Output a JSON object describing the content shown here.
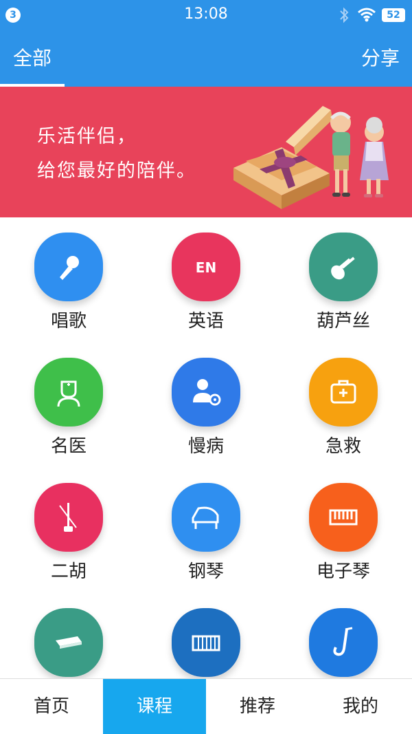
{
  "status_bar": {
    "notification_count": "3",
    "time": "13:08",
    "battery": "52",
    "icons": [
      "bluetooth-icon",
      "wifi-icon",
      "battery-icon"
    ]
  },
  "header": {
    "tab_all": "全部",
    "share": "分享"
  },
  "banner": {
    "line1": "乐活伴侣，",
    "line2": "给您最好的陪伴。"
  },
  "courses": [
    {
      "label": "唱歌",
      "icon": "microphone-icon",
      "color": "#2f8ff0"
    },
    {
      "label": "英语",
      "icon": "english-en-icon",
      "color": "#e8355d"
    },
    {
      "label": "葫芦丝",
      "icon": "hulusi-icon",
      "color": "#3a9c86"
    },
    {
      "label": "名医",
      "icon": "doctor-icon",
      "color": "#3fbf4a"
    },
    {
      "label": "慢病",
      "icon": "patient-gear-icon",
      "color": "#2f7ae8"
    },
    {
      "label": "急救",
      "icon": "first-aid-kit-icon",
      "color": "#f7a10f"
    },
    {
      "label": "二胡",
      "icon": "erhu-icon",
      "color": "#e83060"
    },
    {
      "label": "钢琴",
      "icon": "piano-icon",
      "color": "#2f8ff0"
    },
    {
      "label": "电子琴",
      "icon": "keyboard-instrument-icon",
      "color": "#f7601c"
    },
    {
      "label": "",
      "icon": "harmonica-icon",
      "color": "#3a9c86"
    },
    {
      "label": "",
      "icon": "accordion-icon",
      "color": "#1d6fc0"
    },
    {
      "label": "",
      "icon": "saxophone-icon",
      "color": "#1f7ae0"
    }
  ],
  "bottom_nav": [
    {
      "label": "首页",
      "active": false
    },
    {
      "label": "课程",
      "active": true
    },
    {
      "label": "推荐",
      "active": false
    },
    {
      "label": "我的",
      "active": false
    }
  ],
  "colors": {
    "primary_blue": "#2d93e8",
    "banner_red": "#e8435a",
    "nav_active": "#17a7ee"
  }
}
